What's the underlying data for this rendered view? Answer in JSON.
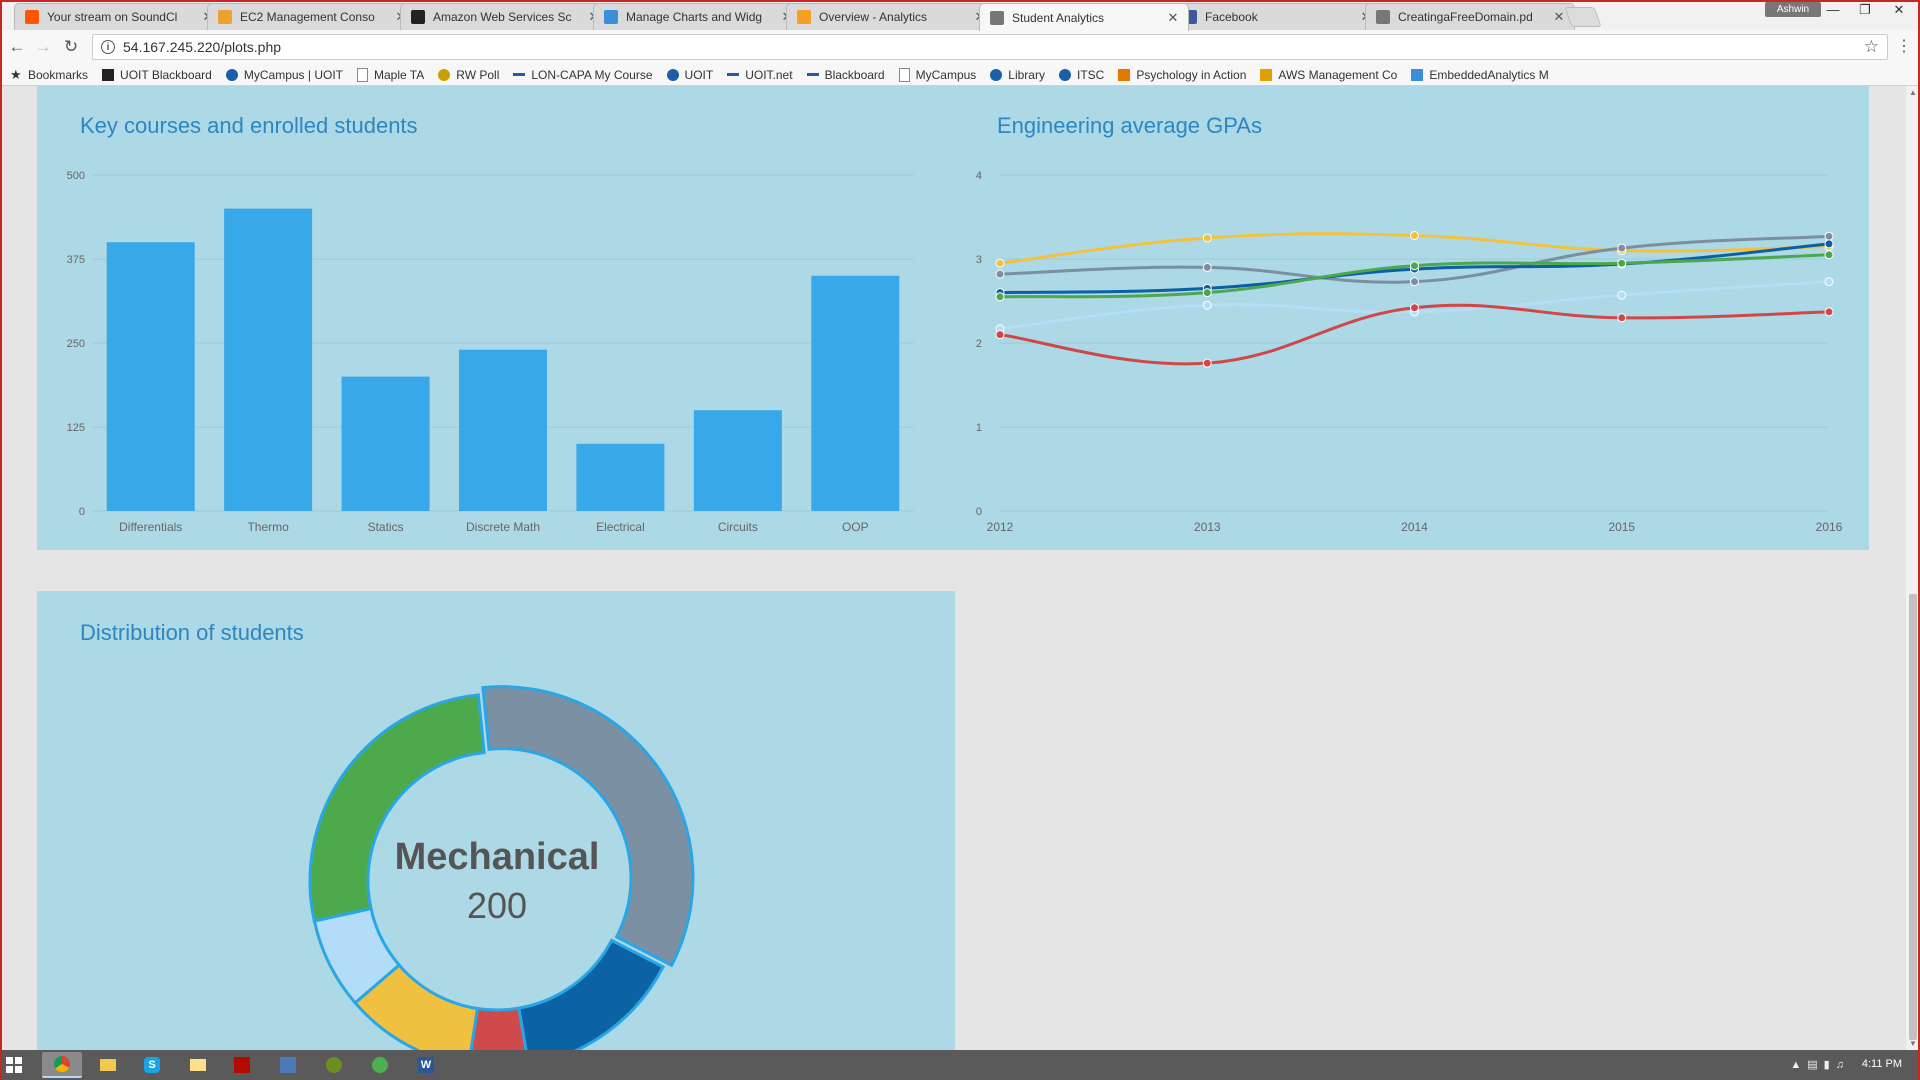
{
  "tabs": [
    {
      "title": "Your stream on SoundCl",
      "fav": "#ff5500"
    },
    {
      "title": "EC2 Management Conso",
      "fav": "#f0a030"
    },
    {
      "title": "Amazon Web Services Sc",
      "fav": "#222222"
    },
    {
      "title": "Manage Charts and Widg",
      "fav": "#3b8ed8"
    },
    {
      "title": "Overview - Analytics",
      "fav": "#f4a024"
    },
    {
      "title": "Student Analytics",
      "fav": "#777777"
    },
    {
      "title": "Facebook",
      "fav": "#3b5998"
    },
    {
      "title": "CreatingaFreeDomain.pd",
      "fav": "#777777"
    }
  ],
  "user": "Ashwin",
  "url": "54.167.245.220/plots.php",
  "bookmarks": [
    {
      "label": "Bookmarks",
      "icon": "star-icon",
      "color": "#333333"
    },
    {
      "label": "UOIT Blackboard",
      "icon": "bb-icon",
      "color": "#222222"
    },
    {
      "label": "MyCampus | UOIT",
      "icon": "shield-icon",
      "color": "#1a5fa8"
    },
    {
      "label": "Maple TA",
      "icon": "page-icon",
      "color": "#888888"
    },
    {
      "label": "RW Poll",
      "icon": "poll-icon",
      "color": "#c8a000"
    },
    {
      "label": "LON-CAPA My Course",
      "icon": "dots-icon",
      "color": "#1a5fa8"
    },
    {
      "label": "UOIT",
      "icon": "shield-icon",
      "color": "#1a5fa8"
    },
    {
      "label": "UOIT.net",
      "icon": "dots-icon",
      "color": "#1a5fa8"
    },
    {
      "label": "Blackboard",
      "icon": "dots-icon",
      "color": "#1a5fa8"
    },
    {
      "label": "MyCampus",
      "icon": "page-icon",
      "color": "#888888"
    },
    {
      "label": "Library",
      "icon": "shield-icon",
      "color": "#1a5fa8"
    },
    {
      "label": "ITSC",
      "icon": "shield-icon",
      "color": "#1a5fa8"
    },
    {
      "label": "Psychology in Action",
      "icon": "bookmark-icon",
      "color": "#e07b00"
    },
    {
      "label": "AWS Management Co",
      "icon": "box-icon",
      "color": "#e0a000"
    },
    {
      "label": "EmbeddedAnalytics M",
      "icon": "chart-icon",
      "color": "#3b8ed8"
    }
  ],
  "panels": {
    "bar_title": "Key courses and enrolled students",
    "line_title": "Engineering average GPAs",
    "donut_title": "Distribution of students"
  },
  "donut_center": {
    "label": "Mechanical",
    "value": "200"
  },
  "taskbar": {
    "clock": "4:11 PM"
  },
  "chart_data": [
    {
      "type": "bar",
      "title": "Key courses and enrolled students",
      "categories": [
        "Differentials",
        "Thermo",
        "Statics",
        "Discrete Math",
        "Electrical",
        "Circuits",
        "OOP"
      ],
      "values": [
        400,
        450,
        200,
        240,
        100,
        150,
        350
      ],
      "ylim": [
        0,
        500
      ],
      "yticks": [
        0,
        125,
        250,
        375,
        500
      ],
      "color": "#38a8e8",
      "grid": true
    },
    {
      "type": "line",
      "title": "Engineering average GPAs",
      "x": [
        "2012",
        "2013",
        "2014",
        "2015",
        "2016"
      ],
      "ylim": [
        0,
        4
      ],
      "yticks": [
        0,
        1,
        2,
        3,
        4
      ],
      "grid": true,
      "series": [
        {
          "color": "#f2c140",
          "values": [
            2.95,
            3.25,
            3.28,
            3.1,
            3.15
          ]
        },
        {
          "color": "#7a8fa0",
          "values": [
            2.82,
            2.9,
            2.73,
            3.13,
            3.27
          ]
        },
        {
          "color": "#0a5fa5",
          "values": [
            2.6,
            2.65,
            2.88,
            2.94,
            3.18
          ]
        },
        {
          "color": "#4ca84c",
          "values": [
            2.55,
            2.6,
            2.92,
            2.95,
            3.05
          ]
        },
        {
          "color": "#b6dcf6",
          "values": [
            2.17,
            2.45,
            2.37,
            2.57,
            2.73
          ]
        },
        {
          "color": "#cf4848",
          "values": [
            2.1,
            1.76,
            2.42,
            2.3,
            2.37
          ]
        }
      ]
    },
    {
      "type": "pie",
      "title": "Distribution of students",
      "labels": [
        "Mechanical",
        "",
        "",
        "",
        "",
        ""
      ],
      "values": [
        200,
        86,
        30,
        66,
        46,
        157
      ],
      "colors": [
        "#7b90a2",
        "#0b62a4",
        "#cf4b4b",
        "#f0c040",
        "#b2dcf7",
        "#4caa4c"
      ],
      "highlighted": "Mechanical"
    }
  ]
}
